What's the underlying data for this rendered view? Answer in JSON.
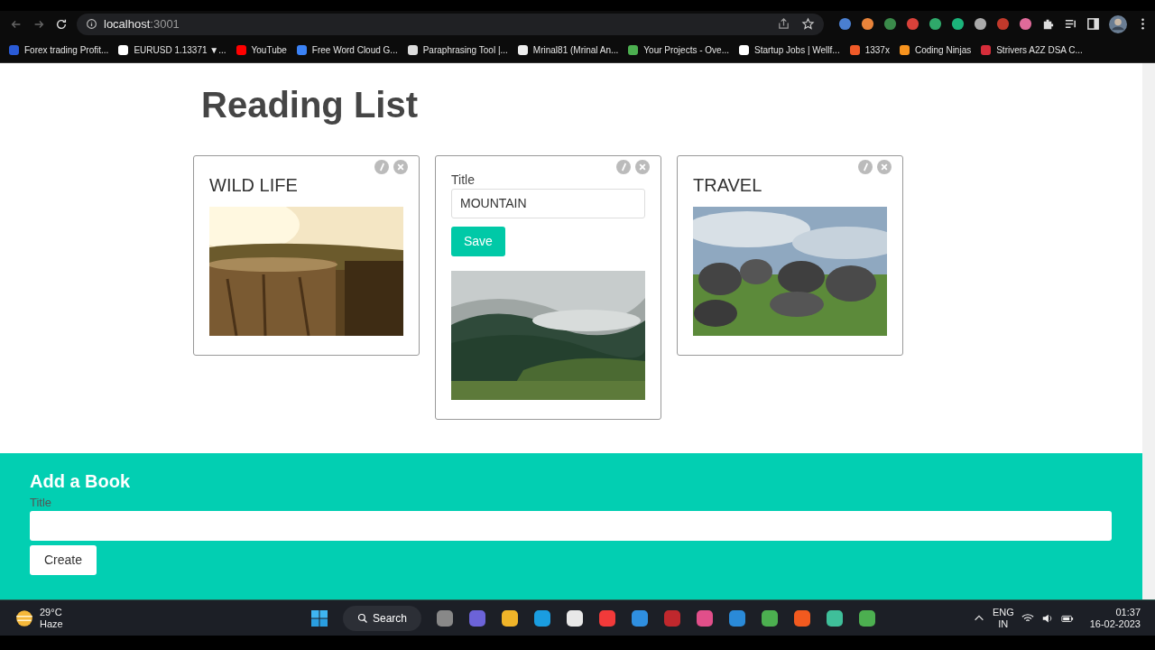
{
  "browser": {
    "address": "localhost",
    "port": ":3001",
    "bookmarks": [
      {
        "label": "Forex trading Profit...",
        "color": "#2a5bd7"
      },
      {
        "label": "EURUSD 1.13371 ▼...",
        "color": "#ffffff"
      },
      {
        "label": "YouTube",
        "color": "#ff0000"
      },
      {
        "label": "Free Word Cloud G...",
        "color": "#3b82f6"
      },
      {
        "label": "Paraphrasing Tool |...",
        "color": "#dddddd"
      },
      {
        "label": "Mrinal81 (Mrinal An...",
        "color": "#eeeeee"
      },
      {
        "label": "Your Projects - Ove...",
        "color": "#4caf50"
      },
      {
        "label": "Startup Jobs | Wellf...",
        "color": "#ffffff"
      },
      {
        "label": "1337x",
        "color": "#f05a28"
      },
      {
        "label": "Coding Ninjas",
        "color": "#f7931e"
      },
      {
        "label": "Strivers A2Z DSA C...",
        "color": "#d62d3a"
      }
    ],
    "extensions": [
      {
        "color": "#4a7fd0"
      },
      {
        "color": "#e8833a"
      },
      {
        "color": "#3a8a4a"
      },
      {
        "color": "#d8413a"
      },
      {
        "color": "#2fa86a"
      },
      {
        "color": "#1bb37a"
      },
      {
        "color": "#aaaaaa"
      },
      {
        "color": "#c0392b"
      },
      {
        "color": "#e06a9a"
      }
    ]
  },
  "page": {
    "heading": "Reading List",
    "books": [
      {
        "kind": "view",
        "title": "WILD LIFE"
      },
      {
        "kind": "edit",
        "field_label": "Title",
        "value": "MOUNTAIN",
        "button": "Save"
      },
      {
        "kind": "view",
        "title": "TRAVEL"
      }
    ],
    "add_form": {
      "heading": "Add a Book",
      "field_label": "Title",
      "button": "Create"
    }
  },
  "taskbar": {
    "temperature": "29°C",
    "weather": "Haze",
    "search": "Search",
    "apps": [
      {
        "color": "#888888"
      },
      {
        "color": "#6c63d8"
      },
      {
        "color": "#f0b429"
      },
      {
        "color": "#1a9de0"
      },
      {
        "color": "#e8e8e8"
      },
      {
        "color": "#f23a3a"
      },
      {
        "color": "#2f8fe0"
      },
      {
        "color": "#c0282d"
      },
      {
        "color": "#e14f8a"
      },
      {
        "color": "#2a8ad8"
      },
      {
        "color": "#4caf50"
      },
      {
        "color": "#f25a1f"
      },
      {
        "color": "#3fbf9a"
      },
      {
        "color": "#4caf50"
      }
    ],
    "language": "ENG",
    "region": "IN",
    "time": "01:37",
    "date": "16-02-2023"
  }
}
